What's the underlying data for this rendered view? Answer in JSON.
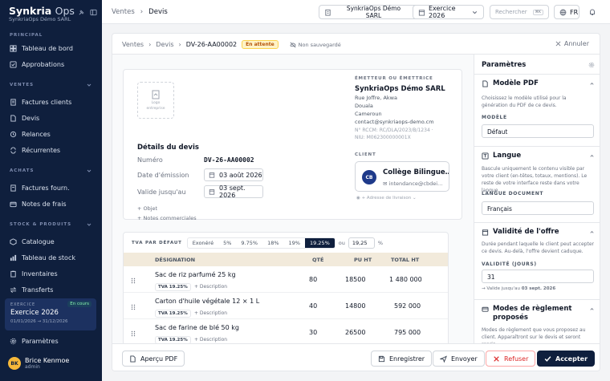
{
  "sidebar": {
    "brand": "Synkria",
    "brand_ops": "Ops",
    "company": "SynkriaOps Démo SARL",
    "sections": [
      {
        "title": "PRINCIPAL",
        "items": [
          "Tableau de bord",
          "Approbations"
        ]
      },
      {
        "title": "VENTES",
        "items": [
          "Factures clients",
          "Devis",
          "Relances",
          "Récurrentes"
        ]
      },
      {
        "title": "ACHATS",
        "items": [
          "Factures fourn.",
          "Notes de frais"
        ]
      },
      {
        "title": "STOCK & PRODUITS",
        "items": [
          "Catalogue",
          "Tableau de stock",
          "Inventaires",
          "Transferts"
        ]
      }
    ],
    "exercise": {
      "label": "EXERCICE",
      "status": "En cours",
      "name": "Exercice 2026",
      "dates": "01/01/2026 → 31/12/2026"
    },
    "settings": "Paramètres",
    "user": {
      "initials": "BK",
      "name": "Brice Kenmoe",
      "role": "admin"
    }
  },
  "topbar": {
    "crumbs": [
      "Ventes",
      "Devis"
    ],
    "company_line1": "SynkriaOps Démo",
    "company_line2": "SARL",
    "fiscal": "Exercice 2026",
    "search_placeholder": "Rechercher",
    "shortcut": "⌘K",
    "lang": "FR"
  },
  "subhead": {
    "crumbs": [
      "Ventes",
      "Devis",
      "DV-26-AA00002"
    ],
    "status": "En attente",
    "unsaved": "Non sauvegardé",
    "cancel": "Annuler"
  },
  "doc": {
    "logo_text_1": "Logo",
    "logo_text_2": "entreprise",
    "title": "Détails du devis",
    "number_label": "Numéro",
    "number": "DV-26-AA00002",
    "issue_label": "Date d'émission",
    "issue_date": "03 août 2026",
    "valid_label": "Valide jusqu'au",
    "valid_date": "03 sept. 2026",
    "add_object": "+ Objet",
    "add_notes": "+ Notes commerciales",
    "issuer": {
      "title": "ÉMETTEUR OU ÉMETTRICE",
      "name": "SynkriaOps Démo SARL",
      "street": "Rue Joffre, Akwa",
      "city": "Douala",
      "country": "Cameroun",
      "email": "contact@synkriaops-demo.cm",
      "rccm": "N° RCCM: RC/DLA/2023/B/1234 ·",
      "niu": "NIU: M062300000001X"
    },
    "client": {
      "title": "CLIENT",
      "initials": "CB",
      "name": "Collège Bilingue…",
      "email": "intendance@cbdei…",
      "delivery": "+ Adresse de livraison"
    }
  },
  "lines": {
    "tva_label": "TVA PAR DÉFAUT",
    "tva_options": [
      "Exonéré",
      "5%",
      "9.75%",
      "18%",
      "19%",
      "19.25%"
    ],
    "tva_selected": "19.25%",
    "or": "ou",
    "custom_value": "19,25",
    "pct": "%",
    "headers": [
      "DÉSIGNATION",
      "QTÉ",
      "PU HT",
      "TOTAL HT"
    ],
    "rows": [
      {
        "name": "Sac de riz parfumé 25 kg",
        "tva": "TVA 19.25%",
        "desc": "+ Description",
        "qty": "80",
        "pu": "18500",
        "total": "1 480 000"
      },
      {
        "name": "Carton d'huile végétale 12 × 1 L",
        "tva": "TVA 19.25%",
        "desc": "+ Description",
        "qty": "40",
        "pu": "14800",
        "total": "592 000"
      },
      {
        "name": "Sac de farine de blé 50 kg",
        "tva": "TVA 19.25%",
        "desc": "+ Description",
        "qty": "30",
        "pu": "26500",
        "total": "795 000"
      }
    ]
  },
  "footer": {
    "preview": "Aperçu PDF",
    "save": "Enregistrer",
    "send": "Envoyer",
    "refuse": "Refuser",
    "accept": "Accepter"
  },
  "settings": {
    "title": "Paramètres",
    "pdf": {
      "title": "Modèle PDF",
      "desc": "Choisissez le modèle utilisé pour la génération du PDF de ce devis.",
      "label": "MODÈLE",
      "value": "Défaut"
    },
    "lang": {
      "title": "Langue",
      "desc": "Bascule uniquement le contenu visible par votre client (en-têtes, totaux, mentions). Le reste de votre interface reste dans votre langue.",
      "label": "LANGUE DOCUMENT",
      "value": "Français"
    },
    "validity": {
      "title": "Validité de l'offre",
      "desc": "Durée pendant laquelle le client peut accepter ce devis. Au-delà, l'offre devient caduque.",
      "label": "VALIDITÉ (JOURS)",
      "value": "31",
      "note_prefix": "→ Valide jusqu'au",
      "note_date": "03 sept. 2026"
    },
    "payment": {
      "title": "Modes de règlement proposés",
      "desc": "Modes de règlement que vous proposez au client. Apparaîtront sur le devis et seront repris"
    }
  },
  "colors": {
    "sidebar": "#0f1f3d",
    "accent": "#0f1f3d",
    "pending": "#b45309",
    "danger": "#dc2626",
    "table_header": "#f2eadb"
  }
}
